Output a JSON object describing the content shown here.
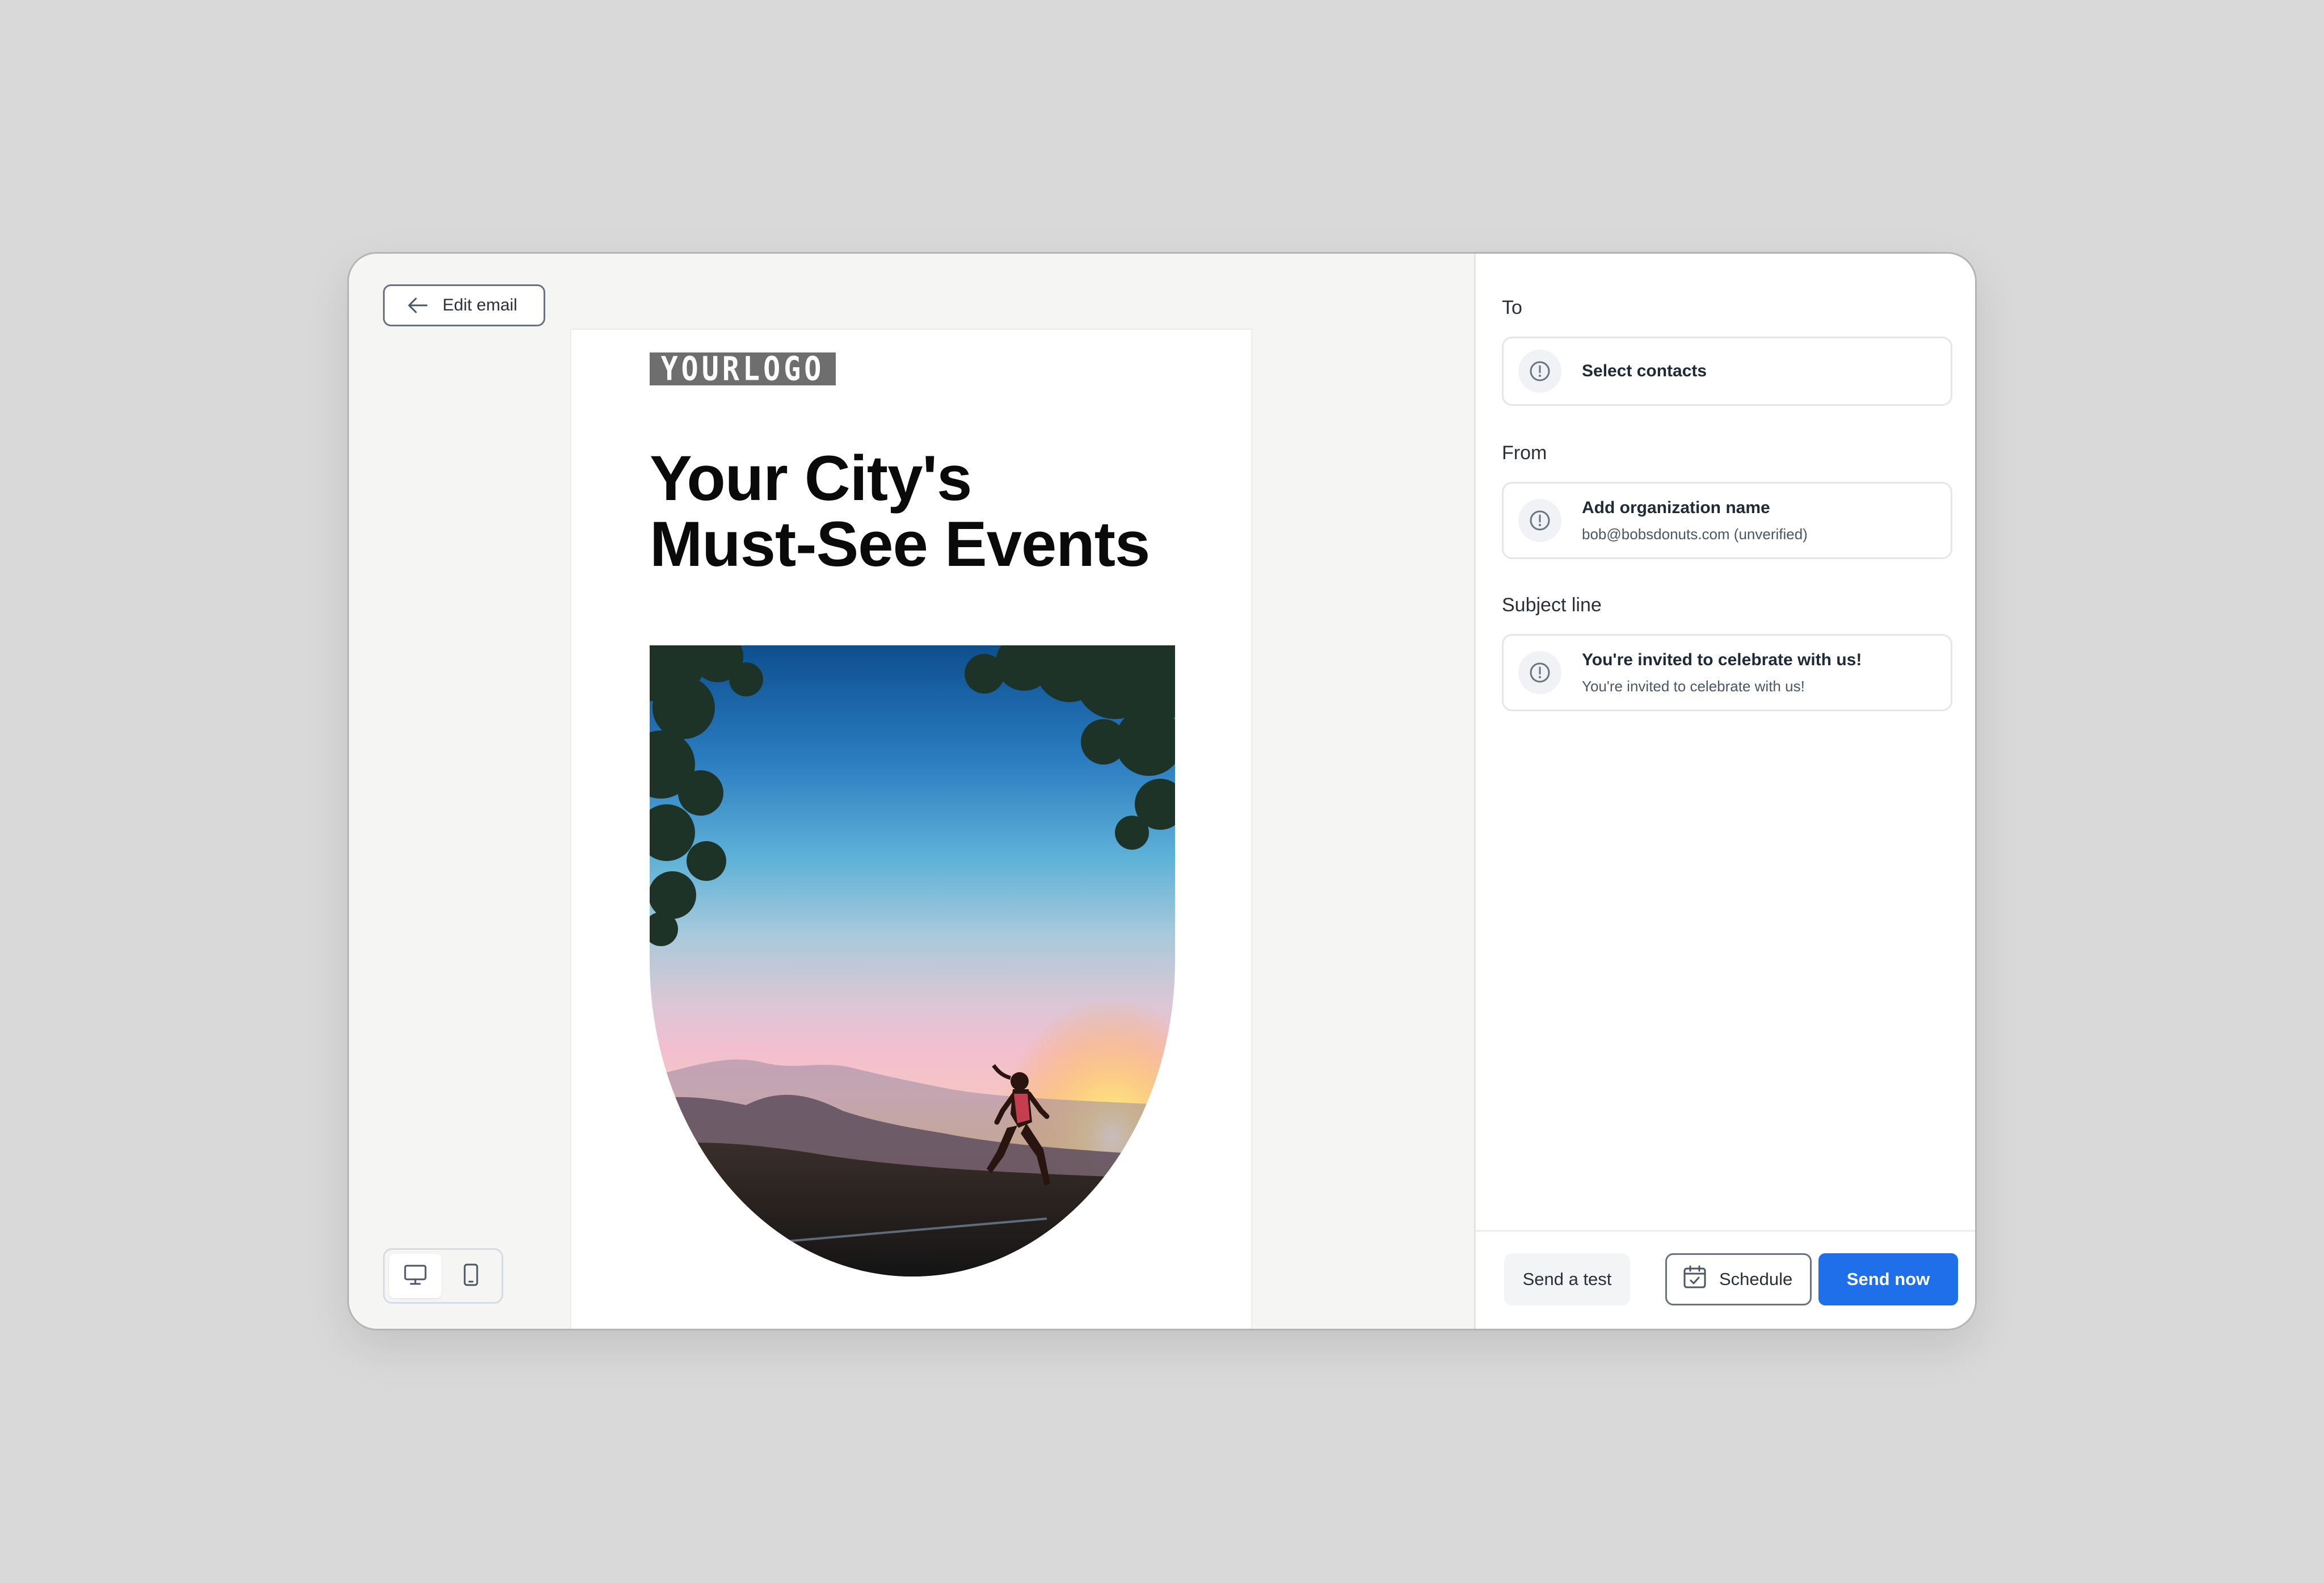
{
  "colors": {
    "page_background": "#d9d9d9",
    "primary_button": "#1f6feb",
    "preview_background": "#f5f5f3"
  },
  "toolbar": {
    "edit_email_label": "Edit email",
    "back_icon": "arrow-left-icon"
  },
  "email": {
    "logo_text": "YOURLOGO",
    "headline_line1": "Your City's",
    "headline_line2": "Must-See Events",
    "hero_image": "runner-at-sunset-photo"
  },
  "device_toggle": {
    "desktop_icon": "desktop-monitor-icon",
    "mobile_icon": "mobile-phone-icon",
    "active": "desktop"
  },
  "settings": {
    "to": {
      "label": "To",
      "primary": "Select contacts"
    },
    "from": {
      "label": "From",
      "primary": "Add organization name",
      "secondary": "bob@bobsdonuts.com (unverified)"
    },
    "subject": {
      "label": "Subject line",
      "primary": "You're invited to celebrate with us!",
      "secondary": "You're invited to celebrate with us!"
    },
    "alert_icon": "alert-circle-icon"
  },
  "footer": {
    "send_test_label": "Send a test",
    "schedule_label": "Schedule",
    "send_now_label": "Send now",
    "calendar_icon": "calendar-icon"
  }
}
